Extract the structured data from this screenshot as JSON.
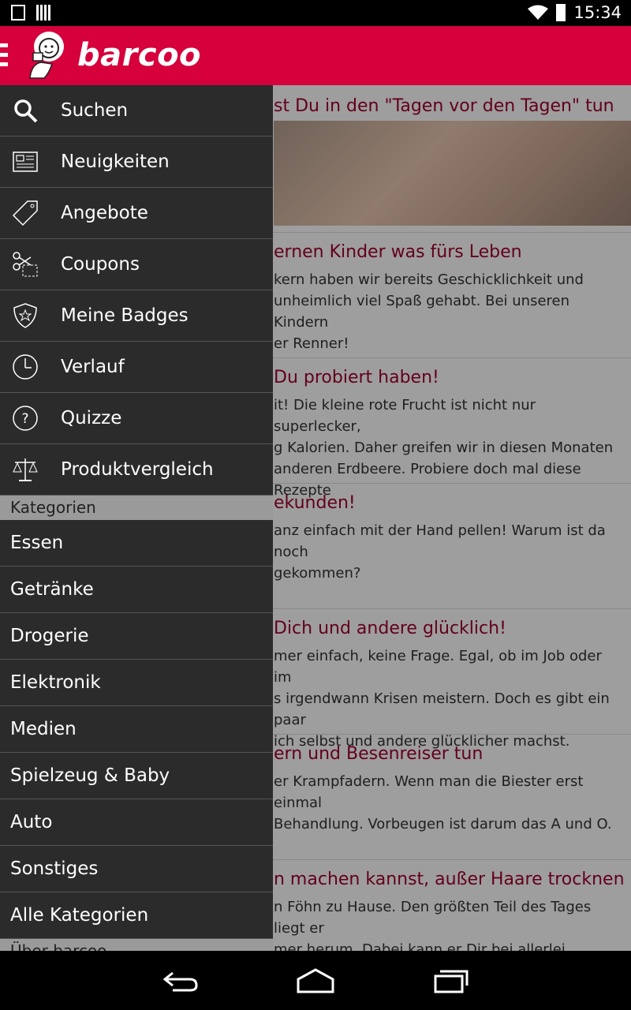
{
  "status": {
    "time": "15:34"
  },
  "app": {
    "brand": "barcoo"
  },
  "drawer": {
    "items": [
      {
        "label": "Suchen",
        "icon": "search-icon"
      },
      {
        "label": "Neuigkeiten",
        "icon": "newspaper-icon"
      },
      {
        "label": "Angebote",
        "icon": "tag-icon"
      },
      {
        "label": "Coupons",
        "icon": "scissors-coupon-icon"
      },
      {
        "label": "Meine Badges",
        "icon": "shield-star-icon"
      },
      {
        "label": "Verlauf",
        "icon": "clock-icon"
      },
      {
        "label": "Quizze",
        "icon": "question-icon"
      },
      {
        "label": "Produktvergleich",
        "icon": "scale-icon"
      }
    ],
    "section_categories": "Kategorien",
    "categories": [
      "Essen",
      "Getränke",
      "Drogerie",
      "Elektronik",
      "Medien",
      "Spielzeug & Baby",
      "Auto",
      "Sonstiges",
      "Alle Kategorien"
    ],
    "section_about": "Über barcoo"
  },
  "articles": [
    {
      "title": "st Du in den \"Tagen vor den Tagen\" tun",
      "lines": []
    },
    {
      "title": "ernen Kinder was fürs Leben",
      "lines": [
        "kern haben wir bereits Geschicklichkeit und",
        "unheimlich viel Spaß gehabt. Bei unseren Kindern",
        "er Renner!"
      ]
    },
    {
      "title": "Du probiert haben!",
      "lines": [
        "it! Die kleine rote Frucht ist nicht nur superlecker,",
        "g Kalorien. Daher greifen wir in diesen Monaten",
        "anderen Erdbeere. Probiere doch mal diese Rezepte"
      ]
    },
    {
      "title": "ekunden!",
      "lines": [
        "anz einfach mit der Hand pellen! Warum ist da noch",
        "gekommen?"
      ]
    },
    {
      "title": "Dich und andere glücklich!",
      "lines": [
        "mer einfach, keine Frage. Egal, ob im Job oder im",
        "s irgendwann Krisen meistern. Doch es gibt ein paar",
        "ich selbst und andere glücklicher machst."
      ]
    },
    {
      "title": "ern und Besenreiser tun",
      "lines": [
        "er Krampfadern. Wenn man die Biester erst einmal",
        "Behandlung. Vorbeugen ist darum das A und O."
      ]
    },
    {
      "title": "n machen kannst, außer Haare trocknen",
      "lines": [
        "n Föhn zu Hause. Den größten Teil des Tages liegt er",
        "mer herum. Dabei kann er Dir bei allerlei"
      ]
    }
  ]
}
